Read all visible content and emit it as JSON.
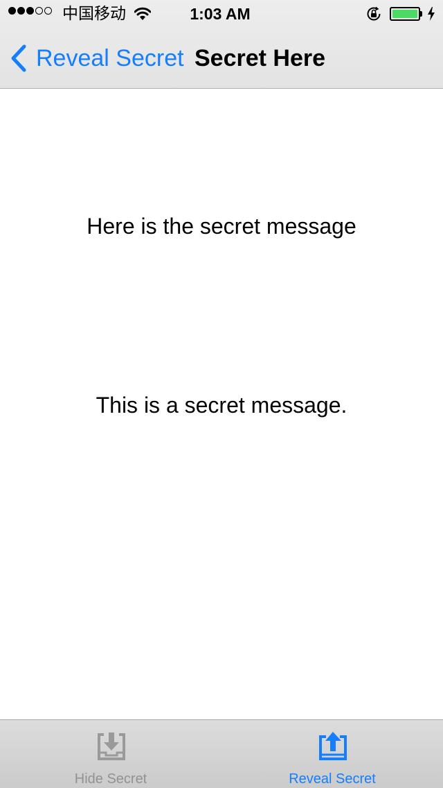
{
  "status_bar": {
    "carrier": "中国移动",
    "time": "1:03 AM",
    "signal_bars_filled": 3,
    "signal_bars_total": 5,
    "battery_level": 1.0,
    "charging": true,
    "icons": [
      "signal-dots",
      "wifi-icon",
      "rotation-lock-icon",
      "battery-icon",
      "charging-bolt-icon"
    ]
  },
  "nav": {
    "back_label": "Reveal Secret",
    "title": "Secret Here",
    "back_icon": "chevron-left-icon"
  },
  "content": {
    "heading": "Here is the secret message",
    "message": "This is a secret message."
  },
  "tabs": [
    {
      "label": "Hide Secret",
      "icon": "tray-download-icon",
      "selected": false
    },
    {
      "label": "Reveal Secret",
      "icon": "tray-upload-icon",
      "selected": true
    }
  ],
  "colors": {
    "accent": "#157efb",
    "inactive": "#929292",
    "battery": "#4cd964",
    "bar_background": "#e6e6e6",
    "tab_background": "#d3d3d3"
  }
}
